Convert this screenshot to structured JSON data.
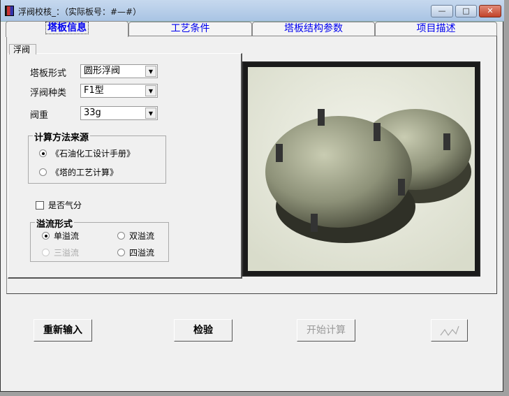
{
  "window": {
    "title": "浮阀校核_：（实际板号：#—#）",
    "minimize": "—",
    "maximize": "□",
    "close": "✕"
  },
  "tabs": [
    {
      "label": "塔板信息",
      "active": true
    },
    {
      "label": "工艺条件"
    },
    {
      "label": "塔板结构参数"
    },
    {
      "label": "项目描述"
    }
  ],
  "subtab": "浮阀",
  "form": {
    "tray_type": {
      "label": "塔板形式",
      "value": "圆形浮阀"
    },
    "valve_type": {
      "label": "浮阀种类",
      "value": "F1型"
    },
    "valve_weight": {
      "label": "阀重",
      "value": "33g"
    }
  },
  "calc_source": {
    "title": "计算方法来源",
    "options": [
      {
        "label": "《石油化工设计手册》",
        "selected": true
      },
      {
        "label": "《塔的工艺计算》",
        "selected": false
      }
    ]
  },
  "gas_split": {
    "label": "是否气分",
    "checked": false
  },
  "overflow": {
    "title": "溢流形式",
    "options": [
      {
        "label": "单溢流",
        "selected": true
      },
      {
        "label": "双溢流"
      },
      {
        "label": "三溢流",
        "disabled": true
      },
      {
        "label": "四溢流"
      }
    ]
  },
  "buttons": {
    "reinput": "重新输入",
    "check": "检验",
    "start": "开始计算"
  },
  "icons": {
    "chart": "chart-line-icon"
  }
}
